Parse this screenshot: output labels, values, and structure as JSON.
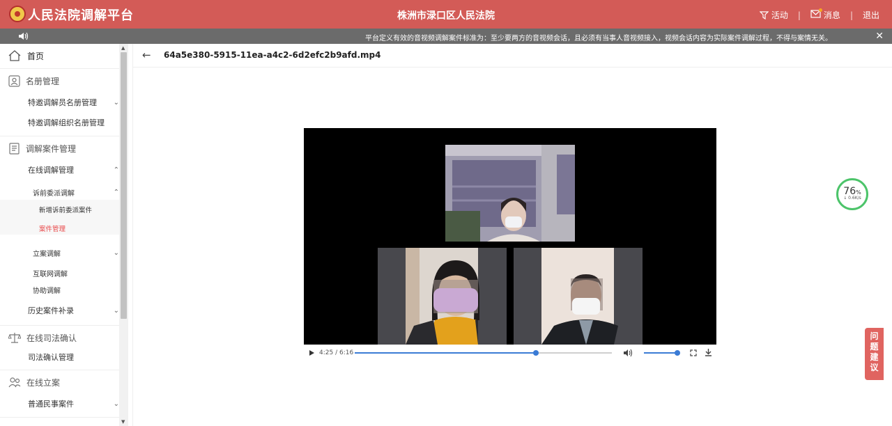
{
  "header": {
    "brand": "人民法院调解平台",
    "court": "株洲市渌口区人民法院",
    "activity_label": "活动",
    "message_label": "消息",
    "logout_label": "退出",
    "separator": "|"
  },
  "notice": {
    "text": "平台定义有效的音视频调解案件标准为：至少要两方的音视频会话，且必须有当事人音视频接入，视频会话内容为实际案件调解过程，不得与案情无关。"
  },
  "sidebar": {
    "home": "首页",
    "roster_section": "名册管理",
    "mediator_roster": "特邀调解员名册管理",
    "org_roster": "特邀调解组织名册管理",
    "case_section": "调解案件管理",
    "online_mediation": "在线调解管理",
    "pre_suit": "诉前委派调解",
    "new_pre_suit": "新增诉前委派案件",
    "case_mgmt": "案件管理",
    "filing_mediation": "立案调解",
    "internet_mediation": "互联网调解",
    "assisted_mediation": "协助调解",
    "history_supplement": "历史案件补录",
    "judicial_section": "在线司法确认",
    "judicial_mgmt": "司法确认管理",
    "filing_section": "在线立案",
    "civil_cases": "普通民事案件"
  },
  "main": {
    "filename": "64a5e380-5915-11ea-a4c2-6d2efc2b9afd.mp4",
    "player": {
      "time": "4:25 / 6:16",
      "progress": 0.704,
      "volume": 1.0
    }
  },
  "widget": {
    "percent": "76",
    "percent_unit": "%",
    "speed": "↓ 0.6K/s"
  },
  "feedback": {
    "label": "问题建议"
  },
  "colors": {
    "topbar": "#d35b57",
    "accent": "#e8484a",
    "player_blue": "#3a7bd5",
    "ring": "#4cc46a"
  }
}
